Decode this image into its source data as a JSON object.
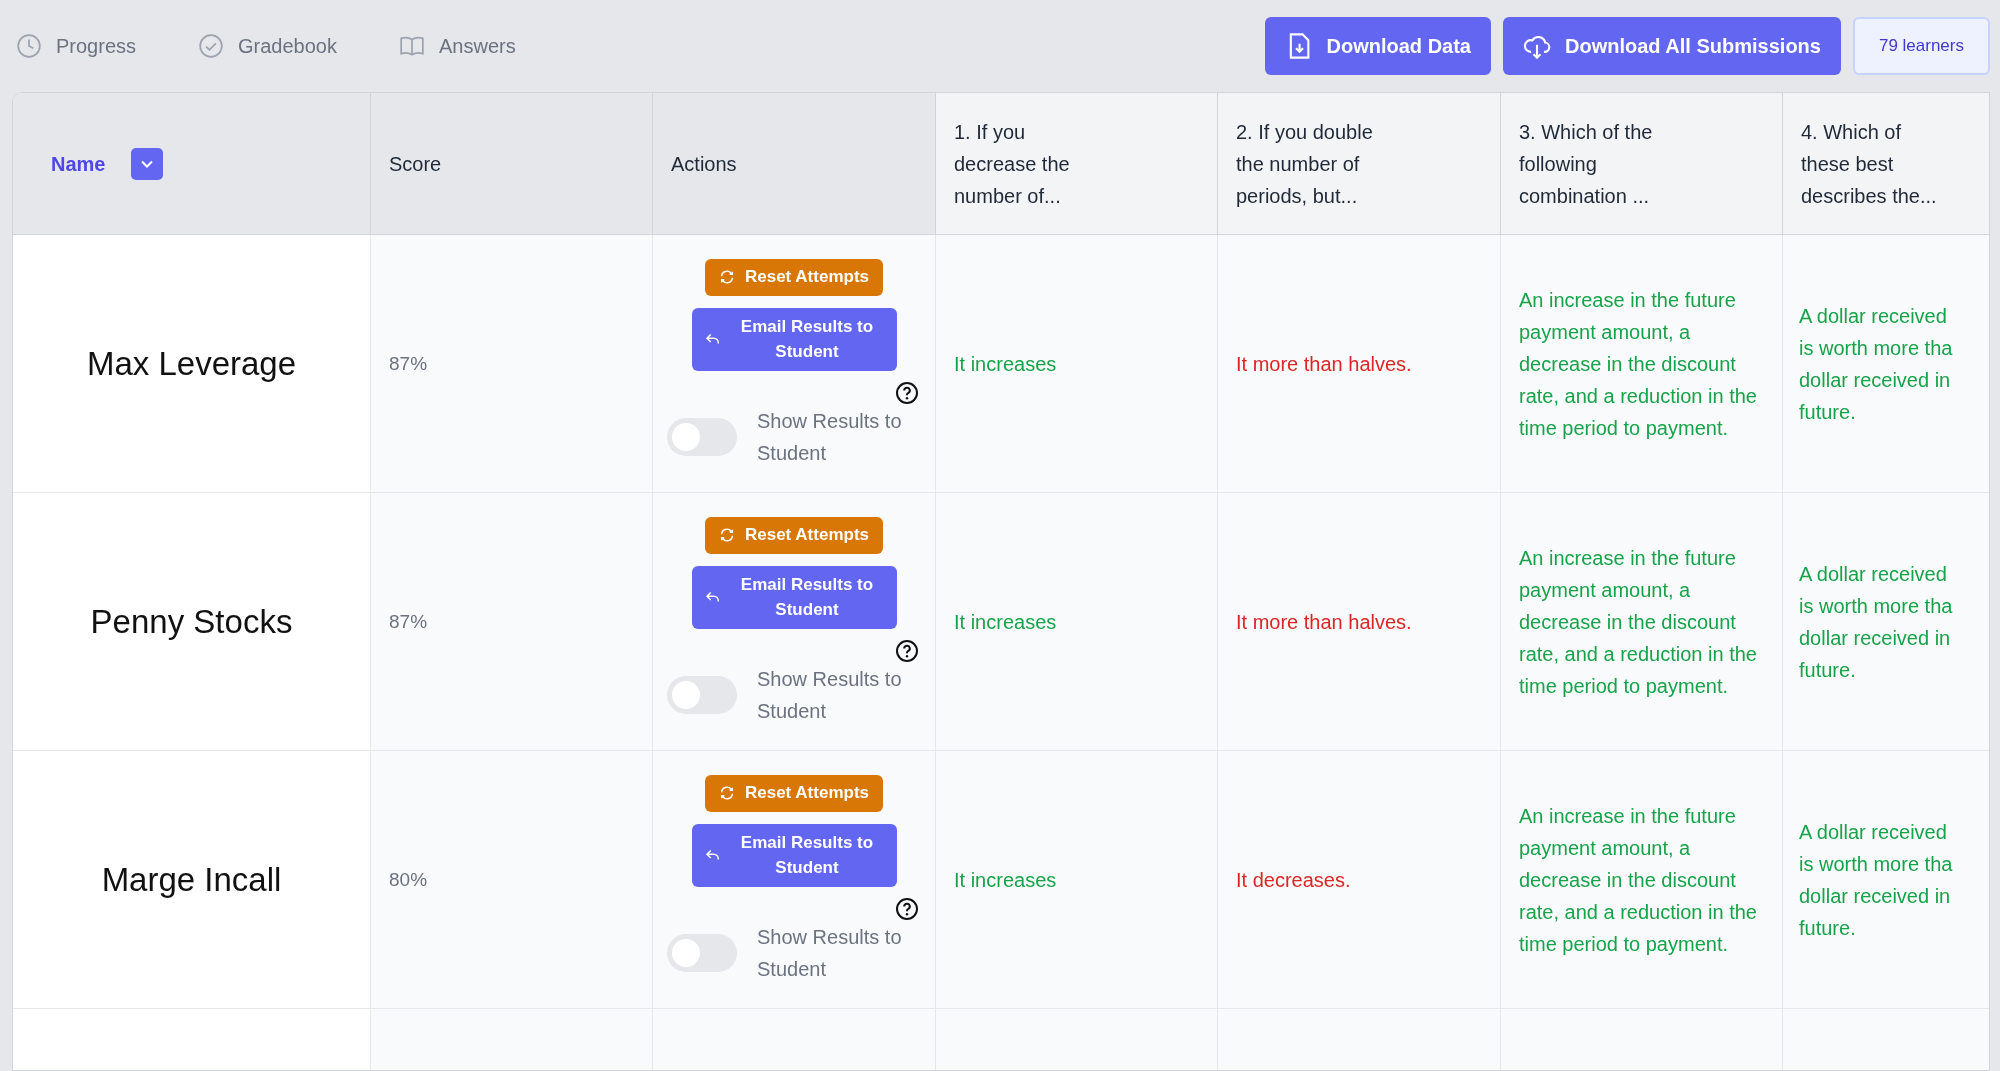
{
  "nav": [
    {
      "label": "Progress"
    },
    {
      "label": "Gradebook"
    },
    {
      "label": "Answers"
    }
  ],
  "buttons": [
    {
      "label": "Download Data"
    },
    {
      "label": "Download All Submissions"
    }
  ],
  "learners": "79 learners",
  "table": {
    "columns": [
      {
        "label": "Name",
        "kind": "sort"
      },
      {
        "label": "Score",
        "kind": "plain"
      },
      {
        "label": "Actions",
        "kind": "plain"
      },
      {
        "label": "1. If you decrease the number of...",
        "kind": "question"
      },
      {
        "label": "2. If you double the number of periods, but...",
        "kind": "question"
      },
      {
        "label": "3. Which of the following combination ...",
        "kind": "question"
      },
      {
        "label": "4. Which of these best describes the...",
        "kind": "question"
      }
    ],
    "rows": [
      {
        "name": "Max Leverage",
        "score": "87%",
        "reset": "Reset Attempts",
        "email": "Email Results to Student",
        "toggle_label": "Show Results to Student",
        "on": false,
        "answers": [
          {
            "text": "It increases",
            "correct": true
          },
          {
            "text": "It more than halves.",
            "correct": false
          },
          {
            "text": "An increase in the future payment amount, a decrease in the discount rate, and a reduction in the time period to payment.",
            "correct": true
          },
          {
            "text": "A dollar received\nis worth more tha\ndollar received in\nfuture.",
            "correct": true
          }
        ]
      },
      {
        "name": "Penny Stocks",
        "score": "87%",
        "reset": "Reset Attempts",
        "email": "Email Results to Student",
        "toggle_label": "Show Results to Student",
        "on": false,
        "answers": [
          {
            "text": "It increases",
            "correct": true
          },
          {
            "text": "It more than halves.",
            "correct": false
          },
          {
            "text": "An increase in the future payment amount, a decrease in the discount rate, and a reduction in the time period to payment.",
            "correct": true
          },
          {
            "text": "A dollar received\nis worth more tha\ndollar received in\nfuture.",
            "correct": true
          }
        ]
      },
      {
        "name": "Marge Incall",
        "score": "80%",
        "reset": "Reset Attempts",
        "email": "Email Results to Student",
        "toggle_label": "Show Results to Student",
        "on": false,
        "answers": [
          {
            "text": "It increases",
            "correct": true
          },
          {
            "text": "It decreases.",
            "correct": false
          },
          {
            "text": "An increase in the future payment amount, a decrease in the discount rate, and a reduction in the time period to payment.",
            "correct": true
          },
          {
            "text": "A dollar received\nis worth more tha\ndollar received in\nfuture.",
            "correct": true
          }
        ]
      }
    ]
  }
}
